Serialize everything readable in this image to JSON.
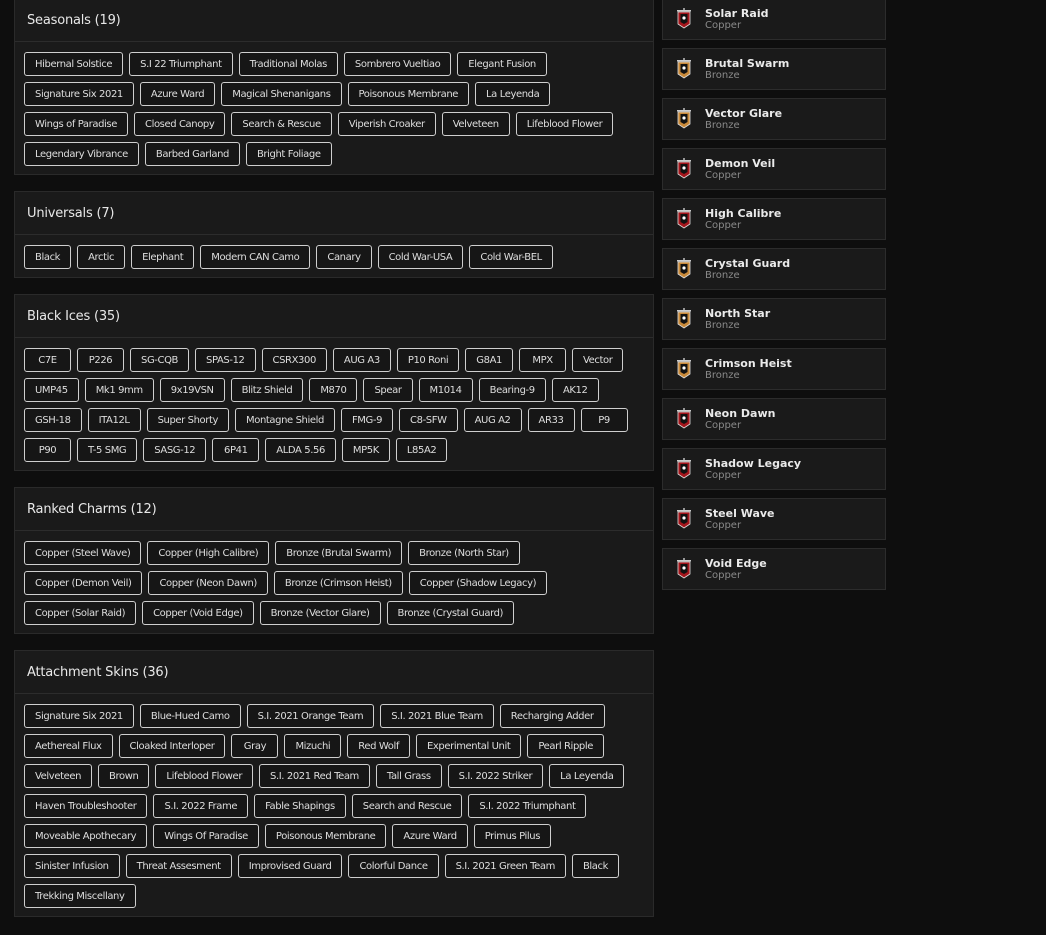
{
  "sections": [
    {
      "title": "Seasonals (19)",
      "items": [
        "Hibernal Solstice",
        "S.I 22 Triumphant",
        "Traditional Molas",
        "Sombrero Vueltiao",
        "Elegant Fusion",
        "Signature Six 2021",
        "Azure Ward",
        "Magical Shenanigans",
        "Poisonous Membrane",
        "La Leyenda",
        "Wings of Paradise",
        "Closed Canopy",
        "Search & Rescue",
        "Viperish Croaker",
        "Velveteen",
        "Lifeblood Flower",
        "Legendary Vibrance",
        "Barbed Garland",
        "Bright Foliage"
      ]
    },
    {
      "title": "Universals (7)",
      "items": [
        "Black",
        "Arctic",
        "Elephant",
        "Modern CAN Camo",
        "Canary",
        "Cold War-USA",
        "Cold War-BEL"
      ]
    },
    {
      "title": "Black Ices (35)",
      "items": [
        "C7E",
        "P226",
        "SG-CQB",
        "SPAS-12",
        "CSRX300",
        "AUG A3",
        "P10 Roni",
        "G8A1",
        "MPX",
        "Vector",
        "UMP45",
        "Mk1 9mm",
        "9x19VSN",
        "Blitz Shield",
        "M870",
        "Spear",
        "M1014",
        "Bearing-9",
        "AK12",
        "GSH-18",
        "ITA12L",
        "Super Shorty",
        "Montagne Shield",
        "FMG-9",
        "C8-SFW",
        "AUG A2",
        "AR33",
        "P9",
        "P90",
        "T-5 SMG",
        "SASG-12",
        "6P41",
        "ALDA 5.56",
        "MP5K",
        "L85A2"
      ]
    },
    {
      "title": "Ranked Charms (12)",
      "items": [
        "Copper (Steel Wave)",
        "Copper (High Calibre)",
        "Bronze (Brutal Swarm)",
        "Bronze (North Star)",
        "Copper (Demon Veil)",
        "Copper (Neon Dawn)",
        "Bronze (Crimson Heist)",
        "Copper (Shadow Legacy)",
        "Copper (Solar Raid)",
        "Copper (Void Edge)",
        "Bronze (Vector Glare)",
        "Bronze (Crystal Guard)"
      ]
    },
    {
      "title": "Attachment Skins (36)",
      "items": [
        "Signature Six 2021",
        "Blue-Hued Camo",
        "S.I. 2021 Orange Team",
        "S.I. 2021 Blue Team",
        "Recharging Adder",
        "Aethereal Flux",
        "Cloaked Interloper",
        "Gray",
        "Mizuchi",
        "Red Wolf",
        "Experimental Unit",
        "Pearl Ripple",
        "Velveteen",
        "Brown",
        "Lifeblood Flower",
        "S.I. 2021 Red Team",
        "Tall Grass",
        "S.I. 2022 Striker",
        "La Leyenda",
        "Haven Troubleshooter",
        "S.I. 2022 Frame",
        "Fable Shapings",
        "Search and Rescue",
        "S.I. 2022 Triumphant",
        "Moveable Apothecary",
        "Wings Of Paradise",
        "Poisonous Membrane",
        "Azure Ward",
        "Primus Pilus",
        "Sinister Infusion",
        "Threat Assesment",
        "Improvised Guard",
        "Colorful Dance",
        "S.I. 2021 Green Team",
        "Black",
        "Trekking Miscellany"
      ]
    }
  ],
  "charms": [
    {
      "name": "Solar Raid",
      "tier": "Copper"
    },
    {
      "name": "Brutal Swarm",
      "tier": "Bronze"
    },
    {
      "name": "Vector Glare",
      "tier": "Bronze"
    },
    {
      "name": "Demon Veil",
      "tier": "Copper"
    },
    {
      "name": "High Calibre",
      "tier": "Copper"
    },
    {
      "name": "Crystal Guard",
      "tier": "Bronze"
    },
    {
      "name": "North Star",
      "tier": "Bronze"
    },
    {
      "name": "Crimson Heist",
      "tier": "Bronze"
    },
    {
      "name": "Neon Dawn",
      "tier": "Copper"
    },
    {
      "name": "Shadow Legacy",
      "tier": "Copper"
    },
    {
      "name": "Steel Wave",
      "tier": "Copper"
    },
    {
      "name": "Void Edge",
      "tier": "Copper"
    }
  ],
  "colors": {
    "Copper": "#a3161c",
    "Bronze": "#c98a3a"
  }
}
